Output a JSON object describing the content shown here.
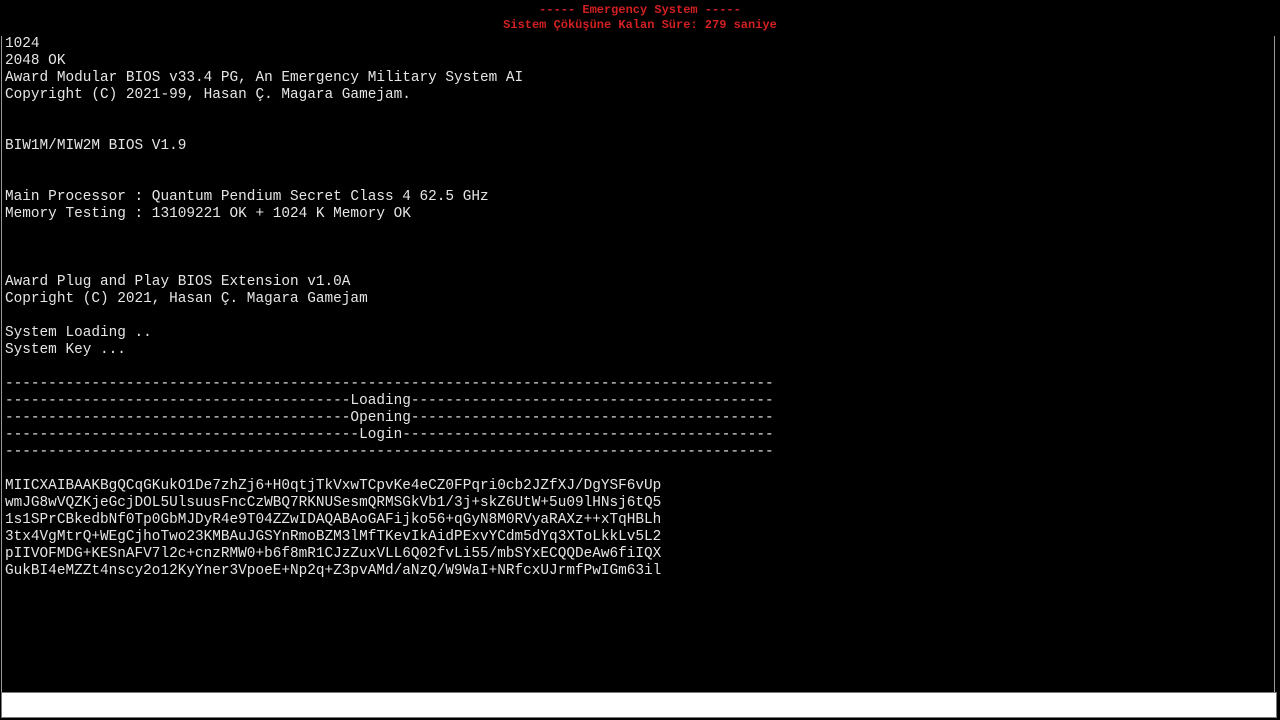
{
  "header": {
    "title": "----- Emergency System -----",
    "countdown": "Sistem Çöküşüne Kalan Süre: 279 saniye"
  },
  "terminal": {
    "lines": [
      "1024",
      "2048 OK",
      "Award Modular BIOS v33.4 PG, An Emergency Military System AI",
      "Copyright (C) 2021-99, Hasan Ç. Magara Gamejam.",
      "",
      "",
      "BIW1M/MIW2M BIOS V1.9",
      "",
      "",
      "Main Processor : Quantum Pendium Secret Class 4 62.5 GHz",
      "Memory Testing : 13109221 OK + 1024 K Memory OK",
      "",
      "",
      "",
      "Award Plug and Play BIOS Extension v1.0A",
      "Copright (C) 2021, Hasan Ç. Magara Gamejam",
      "",
      "System Loading ..",
      "System Key ...",
      "",
      "-----------------------------------------------------------------------------------------",
      "----------------------------------------Loading------------------------------------------",
      "----------------------------------------Opening------------------------------------------",
      "-----------------------------------------Login-------------------------------------------",
      "-----------------------------------------------------------------------------------------",
      "",
      "MIICXAIBAAKBgQCqGKukO1De7zhZj6+H0qtjTkVxwTCpvKe4eCZ0FPqri0cb2JZfXJ/DgYSF6vUp",
      "wmJG8wVQZKjeGcjDOL5UlsuusFncCzWBQ7RKNUSesmQRMSGkVb1/3j+skZ6UtW+5u09lHNsj6tQ5",
      "1s1SPrCBkedbNf0Tp0GbMJDyR4e9T04ZZwIDAQABAoGAFijko56+qGyN8M0RVyaRAXz++xTqHBLh",
      "3tx4VgMtrQ+WEgCjhoTwo23KMBAuJGSYnRmoBZM3lMfTKevIkAidPExvYCdm5dYq3XToLkkLv5L2",
      "pIIVOFMDG+KESnAFV7l2c+cnzRMW0+b6f8mR1CJzZuxVLL6Q02fvLi55/mbSYxECQQDeAw6fiIQX",
      "GukBI4eMZZt4nscy2o12KyYner3VpoeE+Np2q+Z3pvAMd/aNzQ/W9WaI+NRfcxUJrmfPwIGm63il"
    ]
  },
  "input": {
    "value": "",
    "placeholder": ""
  }
}
